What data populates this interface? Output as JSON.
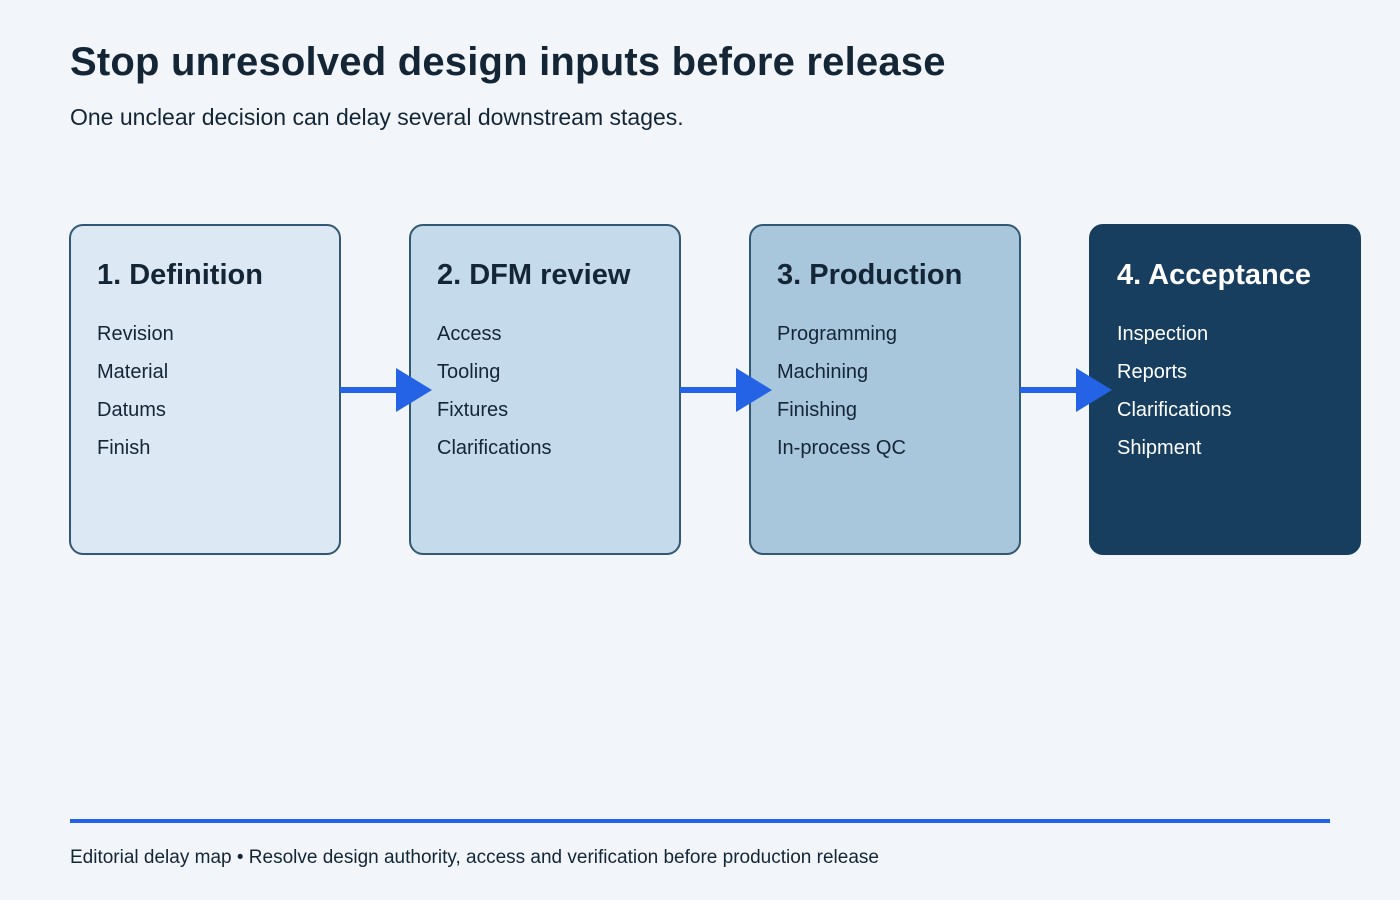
{
  "title": "Stop unresolved design inputs before release",
  "subtitle": "One unclear decision can delay several downstream stages.",
  "colors": {
    "background": "#f2f6fb",
    "text": "#142536",
    "border": "#335873",
    "arrow": "#2463e6",
    "stage_fills": [
      "#dce8f3",
      "#c5daea",
      "#a8c7dd",
      "#173e5f"
    ]
  },
  "stages": [
    {
      "title": "1. Definition",
      "items": [
        "Revision",
        "Material",
        "Datums",
        "Finish"
      ]
    },
    {
      "title": "2. DFM review",
      "items": [
        "Access",
        "Tooling",
        "Fixtures",
        "Clarifications"
      ]
    },
    {
      "title": "3. Production",
      "items": [
        "Programming",
        "Machining",
        "Finishing",
        "In-process QC"
      ]
    },
    {
      "title": "4. Acceptance",
      "items": [
        "Inspection",
        "Reports",
        "Clarifications",
        "Shipment"
      ]
    }
  ],
  "footer": {
    "text": "Editorial delay map • Resolve design authority, access and verification before production release"
  }
}
